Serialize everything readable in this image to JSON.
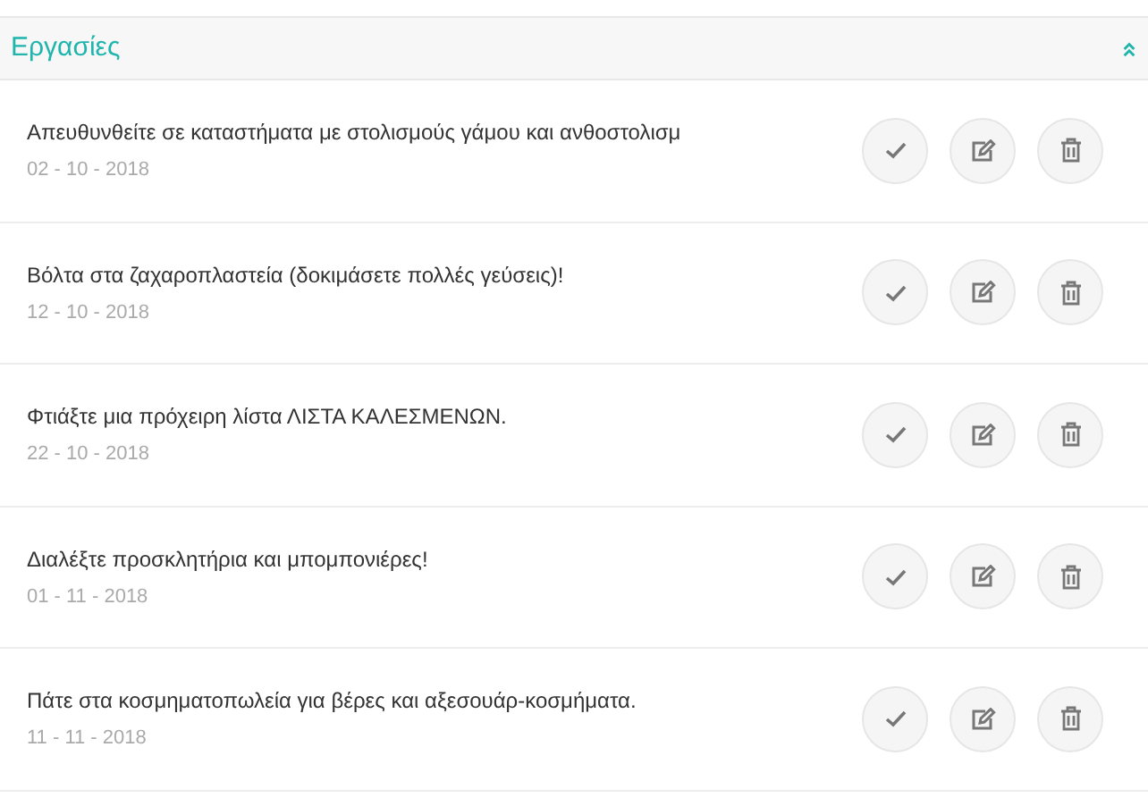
{
  "panel": {
    "title": "Εργασίες"
  },
  "tasks": [
    {
      "text": "Απευθυνθείτε σε καταστήματα με στολισμούς γάμου και ανθοστολισμ",
      "date": "02 - 10 - 2018"
    },
    {
      "text": "Βόλτα στα ζαχαροπλαστεία (δοκιμάσετε πολλές γεύσεις)!",
      "date": "12 - 10 - 2018"
    },
    {
      "text": "Φτιάξτε μια πρόχειρη λίστα ΛΙΣΤΑ ΚΑΛΕΣΜΕΝΩΝ.",
      "date": "22 - 10 - 2018"
    },
    {
      "text": "Διαλέξτε προσκλητήρια και μπομπονιέρες!",
      "date": "01 - 11 - 2018"
    },
    {
      "text": "Πάτε στα κοσμηματοπωλεία για βέρες και αξεσουάρ-κοσμήματα.",
      "date": "11 - 11 - 2018"
    }
  ]
}
